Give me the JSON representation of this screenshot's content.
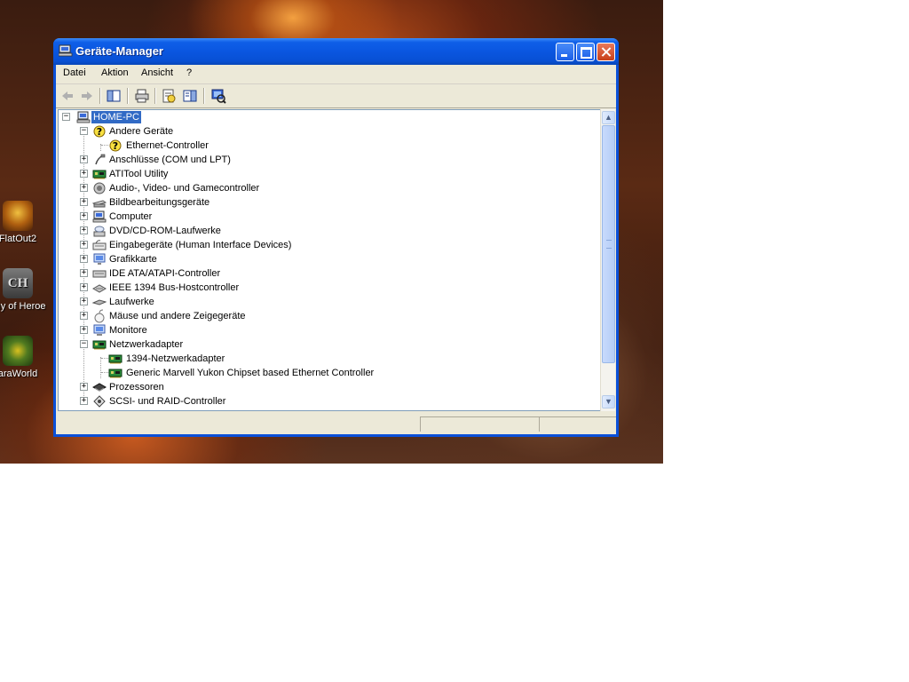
{
  "desktop": {
    "icons": [
      {
        "label": "FlatOut2",
        "icon": "flatout2-icon"
      },
      {
        "label": "any of Heroe",
        "icon": "company-of-heroes-icon"
      },
      {
        "label": "araWorld",
        "icon": "xfire-icon"
      }
    ]
  },
  "window": {
    "title": "Geräte-Manager",
    "controls": [
      "minimize",
      "maximize",
      "close"
    ]
  },
  "menu": [
    "Datei",
    "Aktion",
    "Ansicht",
    "?"
  ],
  "toolbar": [
    "back-icon",
    "forward-icon",
    "console-tree-icon",
    "print-icon",
    "properties-icon",
    "help-icon",
    "scan-hardware-icon"
  ],
  "tree": {
    "root": "HOME-PC",
    "items": [
      {
        "label": "Andere Geräte",
        "icon": "unknown-device-icon",
        "expanded": true
      },
      {
        "label": "Ethernet-Controller",
        "icon": "unknown-device-icon",
        "child": true
      },
      {
        "label": "Anschlüsse (COM und LPT)",
        "icon": "port-icon"
      },
      {
        "label": "ATITool Utility",
        "icon": "board-icon"
      },
      {
        "label": "Audio-, Video- und Gamecontroller",
        "icon": "speaker-icon"
      },
      {
        "label": "Bildbearbeitungsgeräte",
        "icon": "scanner-icon"
      },
      {
        "label": "Computer",
        "icon": "computer-icon"
      },
      {
        "label": "DVD/CD-ROM-Laufwerke",
        "icon": "cdrom-icon"
      },
      {
        "label": "Eingabegeräte (Human Interface Devices)",
        "icon": "keyboard-icon"
      },
      {
        "label": "Grafikkarte",
        "icon": "display-icon"
      },
      {
        "label": "IDE ATA/ATAPI-Controller",
        "icon": "ide-icon"
      },
      {
        "label": "IEEE 1394 Bus-Hostcontroller",
        "icon": "firewire-icon"
      },
      {
        "label": "Laufwerke",
        "icon": "disk-drive-icon"
      },
      {
        "label": "Mäuse und andere Zeigegeräte",
        "icon": "mouse-icon"
      },
      {
        "label": "Monitore",
        "icon": "monitor-icon"
      },
      {
        "label": "Netzwerkadapter",
        "icon": "board-icon",
        "expanded": true
      },
      {
        "label": "1394-Netzwerkadapter",
        "icon": "board-icon",
        "child": true
      },
      {
        "label": "Generic Marvell Yukon Chipset based Ethernet Controller",
        "icon": "board-icon",
        "child": true
      },
      {
        "label": "Prozessoren",
        "icon": "cpu-icon"
      },
      {
        "label": "SCSI- und RAID-Controller",
        "icon": "scsi-icon"
      }
    ]
  }
}
